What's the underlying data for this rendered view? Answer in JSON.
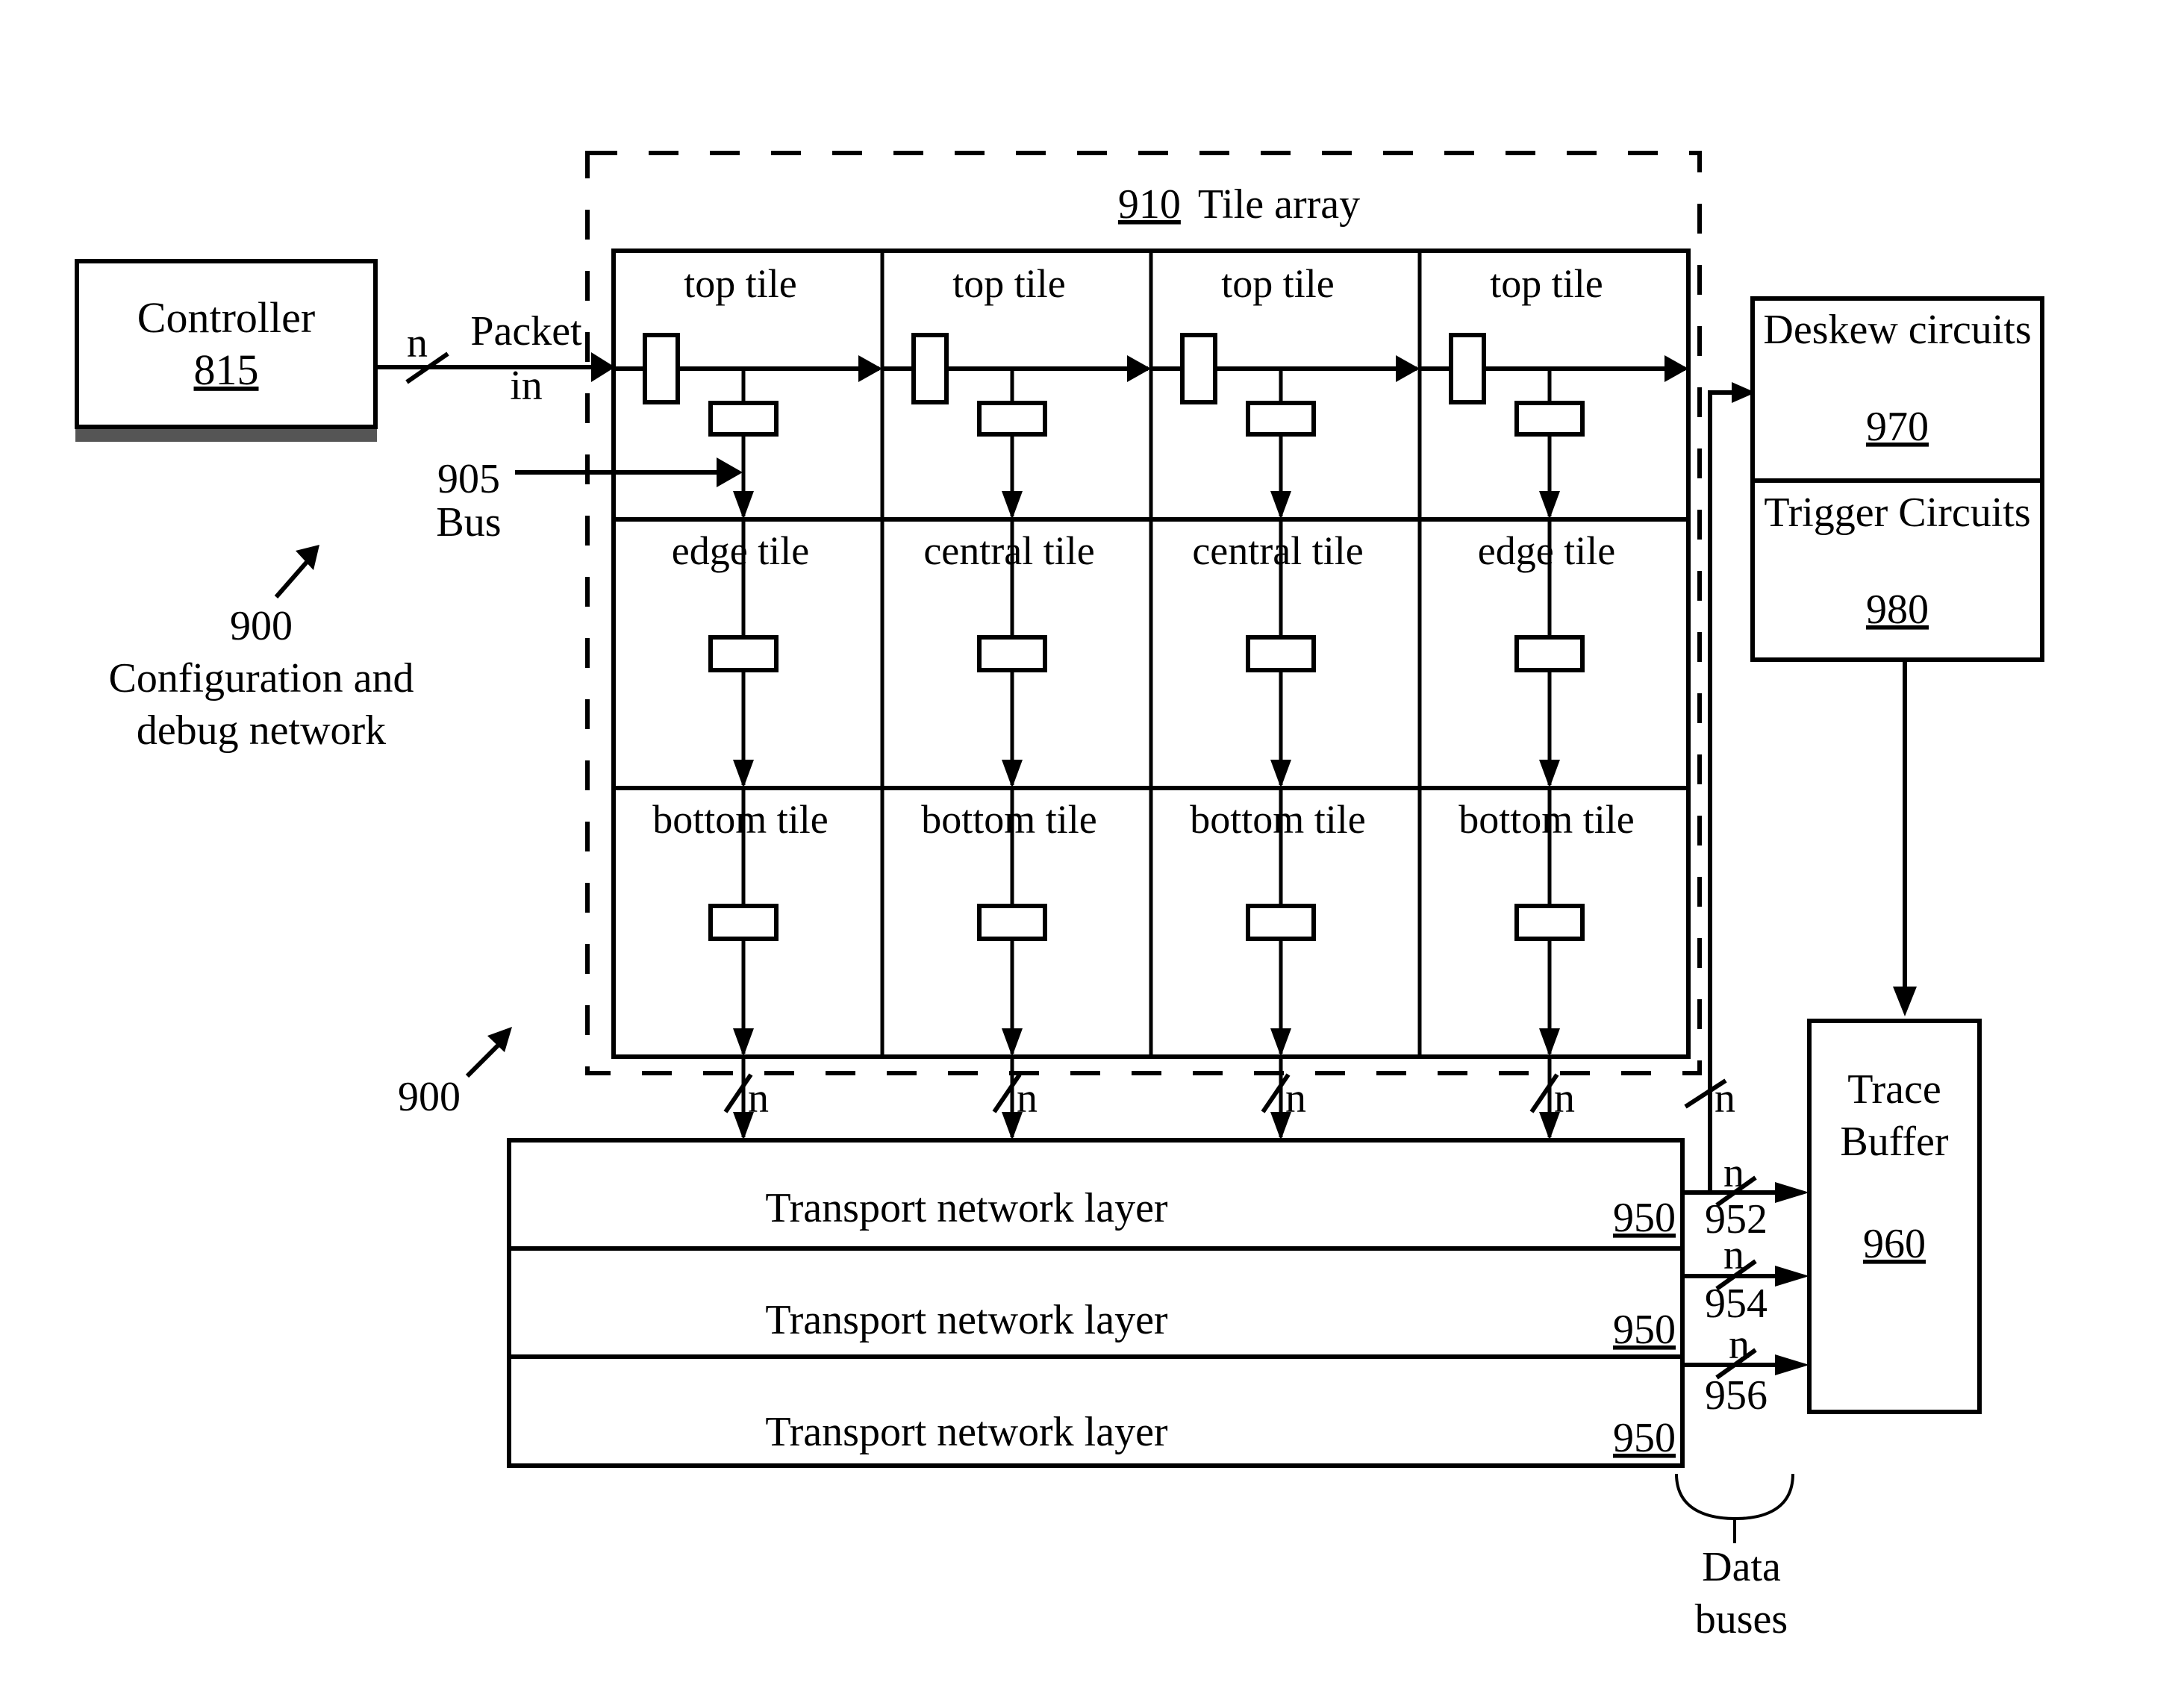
{
  "colors": {
    "ink": "#000000",
    "background": "#ffffff",
    "shadow": "#555555"
  },
  "controller": {
    "title": "Controller",
    "ref": "815"
  },
  "packet_in": {
    "line1": "Packet",
    "line2": "in",
    "width_label": "n"
  },
  "bus": {
    "ref": "905",
    "label": "Bus"
  },
  "network_label": {
    "ref": "900",
    "line1": "Configuration and",
    "line2": "debug network"
  },
  "network_ref_2": "900",
  "tile_array": {
    "ref": "910",
    "title": "Tile array",
    "rows": [
      [
        "top tile",
        "top tile",
        "top tile",
        "top tile"
      ],
      [
        "edge tile",
        "central tile",
        "central tile",
        "edge tile"
      ],
      [
        "bottom tile",
        "bottom tile",
        "bottom tile",
        "bottom tile"
      ]
    ],
    "output_width_label": "n"
  },
  "transport_layers": [
    {
      "label": "Transport network layer",
      "ref": "950"
    },
    {
      "label": "Transport network layer",
      "ref": "950"
    },
    {
      "label": "Transport network layer",
      "ref": "950"
    }
  ],
  "data_buses": [
    {
      "width_label": "n",
      "ref": "952"
    },
    {
      "width_label": "n",
      "ref": "954"
    },
    {
      "width_label": "n",
      "ref": "956"
    }
  ],
  "data_buses_caption": {
    "line1": "Data",
    "line2": "buses"
  },
  "feedback_width_label": "n",
  "deskew": {
    "title": "Deskew circuits",
    "ref": "970"
  },
  "trigger": {
    "title": "Trigger Circuits",
    "ref": "980"
  },
  "trace_buffer": {
    "line1": "Trace",
    "line2": "Buffer",
    "ref": "960"
  }
}
